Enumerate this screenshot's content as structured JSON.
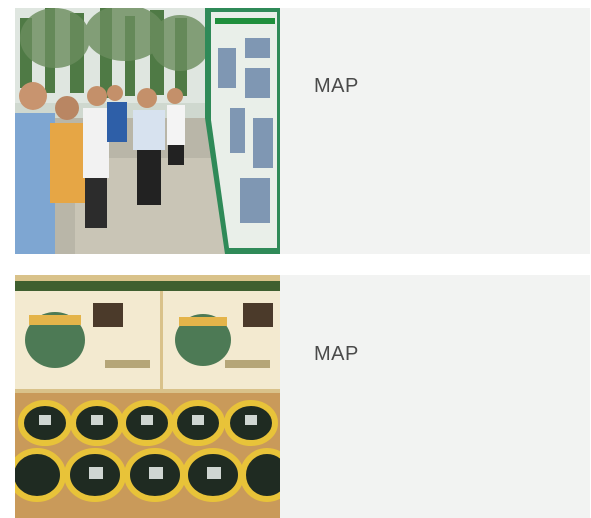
{
  "items": [
    {
      "caption": "MAP",
      "image": "photo-people-viewing-display-boards"
    },
    {
      "caption": "MAP",
      "image": "photo-melon-gift-boxes"
    }
  ]
}
